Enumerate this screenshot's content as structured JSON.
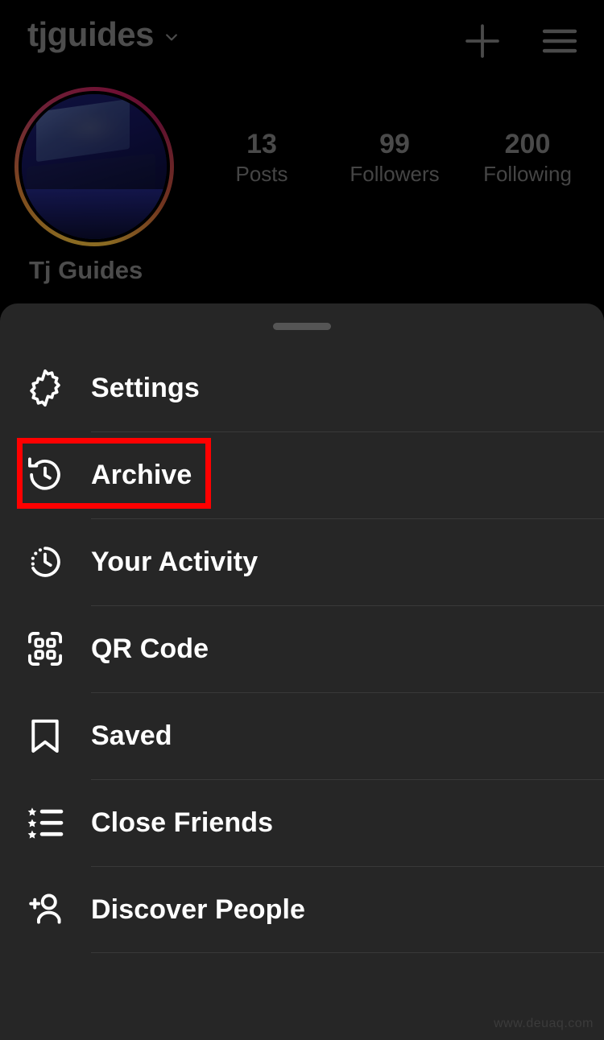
{
  "header": {
    "username": "tjguides",
    "chevron_icon": "chevron-down-icon",
    "add_icon": "plus-icon",
    "menu_icon": "hamburger-menu-icon"
  },
  "profile": {
    "display_name": "Tj Guides",
    "avatar_alt": "profile-photo-desk-setup",
    "has_story_ring": true,
    "stats": [
      {
        "value": "13",
        "label": "Posts"
      },
      {
        "value": "99",
        "label": "Followers"
      },
      {
        "value": "200",
        "label": "Following"
      }
    ]
  },
  "sheet": {
    "handle": "drag-handle",
    "items": [
      {
        "label": "Settings",
        "icon": "gear-icon"
      },
      {
        "label": "Archive",
        "icon": "archive-clock-icon"
      },
      {
        "label": "Your Activity",
        "icon": "activity-clock-icon"
      },
      {
        "label": "QR Code",
        "icon": "qr-code-icon"
      },
      {
        "label": "Saved",
        "icon": "bookmark-icon"
      },
      {
        "label": "Close Friends",
        "icon": "star-list-icon"
      },
      {
        "label": "Discover People",
        "icon": "person-add-icon"
      }
    ]
  },
  "annotation": {
    "target": "Archive",
    "color": "#ff0000"
  },
  "watermark": {
    "text": "www.deuaq.com"
  },
  "colors": {
    "page_background": "#000000",
    "sheet_background": "#262626",
    "divider": "#393939",
    "label_text": "#ffffff",
    "dimmed_text": "#4a4a4a",
    "highlight": "#ff0000"
  }
}
